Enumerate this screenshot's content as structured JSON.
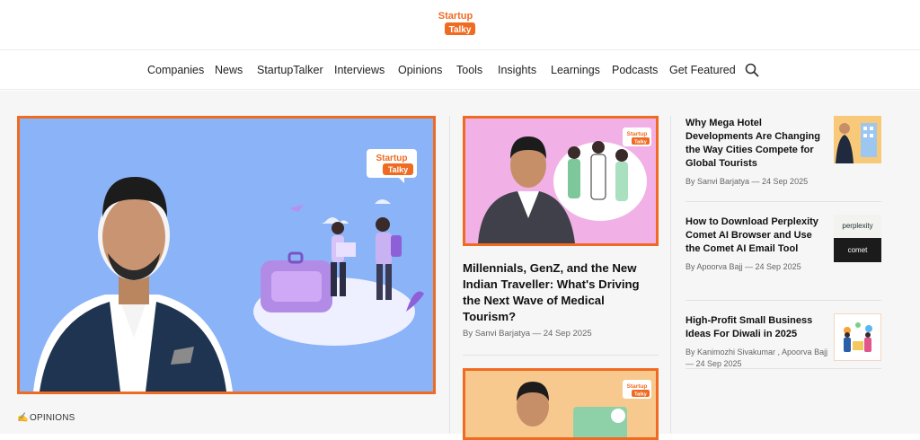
{
  "logo": {
    "line1": "Startup",
    "line2": "Talky"
  },
  "nav": {
    "items": [
      "Companies",
      "News",
      "StartupTalker",
      "Interviews",
      "Opinions",
      "Tools",
      "Insights",
      "Learnings",
      "Podcasts",
      "Get Featured"
    ],
    "search_icon": "search-icon"
  },
  "hero": {
    "badge_line1": "Startup",
    "badge_line2": "Talky",
    "category": "OPINIONS",
    "category_icon": "pen-icon"
  },
  "middle": {
    "badge_line1": "Startup",
    "badge_line2": "Talky",
    "title": "Millennials, GenZ, and the New Indian Traveller: What's Driving the Next Wave of Medical Tourism?",
    "meta": "By Sanvi Barjatya — 24 Sep 2025",
    "badge2_line1": "Startup",
    "badge2_line2": "Talky"
  },
  "right": [
    {
      "title": "Why Mega Hotel Developments Are Changing the Way Cities Compete for Global Tourists",
      "meta": "By Sanvi Barjatya — 24 Sep 2025"
    },
    {
      "title": "How to Download Perplexity Comet AI Browser and Use the Comet AI Email Tool",
      "meta": "By Apoorva Bajj — 24 Sep 2025",
      "thumb_top": "perplexity",
      "thumb_bottom": "comet"
    },
    {
      "title": "High-Profit Small Business Ideas For Diwali in 2025",
      "meta": "By Kanimozhi Sivakumar , Apoorva Bajj — 24 Sep 2025"
    }
  ],
  "colors": {
    "accent": "#f06b22",
    "hero_bg": "#8ab3f8",
    "mid_bg": "#f1b1e6",
    "mid2_bg": "#f8c98e"
  }
}
